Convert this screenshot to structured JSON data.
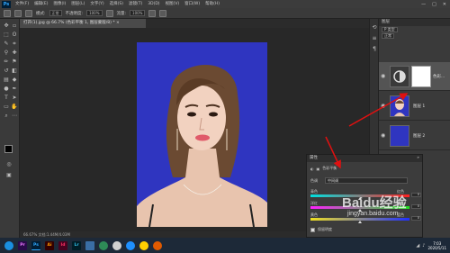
{
  "app": {
    "logo_text": "Ps"
  },
  "menubar": {
    "items": [
      "文件(F)",
      "编辑(E)",
      "图像(I)",
      "图层(L)",
      "文字(Y)",
      "选择(S)",
      "滤镜(T)",
      "3D(D)",
      "视图(V)",
      "窗口(W)",
      "帮助(H)"
    ],
    "window_buttons": [
      "—",
      "□",
      "✕"
    ]
  },
  "options": {
    "mode_label": "模式:",
    "mode_value": "正常",
    "opacity_label": "不透明度:",
    "opacity_value": "100%",
    "flow_label": "流量:",
    "flow_value": "100%"
  },
  "document": {
    "tab_title": "打开(1).jpg @ 66.7% (色彩平衡 1, 图层蒙版/8) *",
    "tab_close": "×",
    "status_text": "66.67%    文档:1.44M/4.03M"
  },
  "layers": {
    "header": "图层",
    "filter_label": "P 类型",
    "blend_mode": "正常",
    "items": [
      {
        "name": "色彩...",
        "type": "adjustment"
      },
      {
        "name": "图层 1",
        "type": "photo"
      },
      {
        "name": "图层 2",
        "type": "fill"
      }
    ]
  },
  "properties": {
    "header": "属性",
    "title": "色彩平衡",
    "tone_label": "色调",
    "tone_value": "中间调",
    "sliders": [
      {
        "left": "青色",
        "right": "红色",
        "value": 0
      },
      {
        "left": "洋红",
        "right": "绿色",
        "value": 0
      },
      {
        "left": "黄色",
        "right": "蓝色",
        "value": 0
      }
    ],
    "preserve_label": "保留明度"
  },
  "taskbar": {
    "apps": [
      {
        "label": "Pr",
        "color": "#2a0a4a",
        "fg": "#ea77ff"
      },
      {
        "label": "Ps",
        "color": "#001e36",
        "fg": "#31a8ff"
      },
      {
        "label": "Ai",
        "color": "#330000",
        "fg": "#ff9a00"
      },
      {
        "label": "Id",
        "color": "#49021f",
        "fg": "#ff3366"
      },
      {
        "label": "Lr",
        "color": "#001d26",
        "fg": "#31c5f0"
      },
      {
        "label": "",
        "color": "#3a6ea5",
        "fg": "#fff"
      },
      {
        "label": "",
        "color": "#2e8b57",
        "fg": "#fff"
      },
      {
        "label": "",
        "color": "#d0d0d0",
        "fg": "#000"
      },
      {
        "label": "",
        "color": "#1e90ff",
        "fg": "#fff"
      },
      {
        "label": "",
        "color": "#ffd000",
        "fg": "#000"
      },
      {
        "label": "",
        "color": "#e05a00",
        "fg": "#fff"
      }
    ],
    "time": "7:03",
    "date": "2020/5/11"
  },
  "watermark": {
    "text": "Baidu经验",
    "url": "jingyan.baidu.com"
  },
  "colors": {
    "canvas_bg": "#2f35c0",
    "arrow": "#e01010"
  }
}
